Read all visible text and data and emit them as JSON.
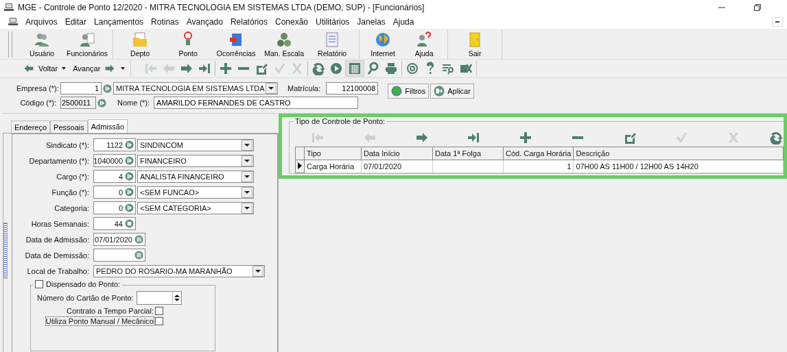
{
  "window": {
    "title": "MGE - Controle de Ponto 12/2020 - MITRA TECNOLOGIA EM SISTEMAS LTDA (DEMO, SUP) - [Funcionários]"
  },
  "menu": [
    "Arquivos",
    "Editar",
    "Lançamentos",
    "Rotinas",
    "Avançado",
    "Relatórios",
    "Conexão",
    "Utilitários",
    "Janelas",
    "Ajuda"
  ],
  "toolbar": {
    "groups": [
      [
        "Usuário",
        "Funcionários"
      ],
      [
        "Depto",
        "Ponto",
        "Ocorrências",
        "Man. Escala",
        "Relatório"
      ],
      [
        "Internet",
        "Ajuda"
      ],
      [
        "Sair"
      ]
    ]
  },
  "nav": {
    "back": "Voltar",
    "forward": "Avançar",
    "buttons": [
      {
        "disabled": true
      },
      {
        "disabled": true
      },
      {
        "disabled": false
      },
      {
        "disabled": false
      },
      {
        "disabled": false
      },
      {
        "disabled": false
      },
      {
        "disabled": false
      },
      {
        "disabled": true
      },
      {
        "disabled": true
      },
      {
        "disabled": false
      },
      {
        "disabled": false
      },
      {
        "disabled": false
      },
      {
        "disabled": false
      },
      {
        "disabled": false
      },
      {
        "disabled": false
      },
      {
        "disabled": false
      },
      {
        "disabled": false
      },
      {
        "disabled": false
      }
    ]
  },
  "header": {
    "empresa": {
      "label": "Empresa (*):",
      "code": "1",
      "name": "MITRA TECNOLOGIA EM SISTEMAS LTDA"
    },
    "matricula": {
      "label": "Matrícula:",
      "value": "12100008"
    },
    "codigo": {
      "label": "Código (*):",
      "value": "2500011"
    },
    "nome": {
      "label": "Nome (*):",
      "value": "AMARILDO FERNANDES DE CASTRO"
    },
    "buttons": [
      "Filtros",
      "Aplicar"
    ]
  },
  "tabs": [
    {
      "label": "Endereço",
      "selected": false
    },
    {
      "label": "Pessoais",
      "selected": false
    },
    {
      "label": "Admissão",
      "selected": true
    }
  ],
  "form": [
    {
      "kind": "lookup",
      "label": "Sindicato (*):",
      "code": "1122",
      "value": "SINDINCOM"
    },
    {
      "kind": "lookup",
      "label": "Departamento (*):",
      "code": "1040000",
      "value": "FINANCEIRO"
    },
    {
      "kind": "lookup",
      "label": "Cargo (*):",
      "code": "4",
      "value": "ANALISTA FINANCEIRO"
    },
    {
      "kind": "lookup",
      "label": "Função (*):",
      "code": "0",
      "value": "<SEM FUNCAO>"
    },
    {
      "kind": "lookup",
      "label": "Categoria:",
      "code": "0",
      "value": "<SEM CATEGORIA>"
    },
    {
      "kind": "number",
      "label": "Horas Semanais:",
      "value": "44"
    },
    {
      "kind": "date",
      "label": "Data de Admissão:",
      "value": "07/01/2020"
    },
    {
      "kind": "date",
      "label": "Data de Demissão:"
    },
    {
      "kind": "combo",
      "label": "Local de Trabalho:",
      "value": "PEDRO DO ROSARIO-MA MARANHÃO"
    }
  ],
  "dispensado": {
    "label": "Dispensado do Ponto:",
    "checked": false,
    "cartao": {
      "label": "Número do Cartão de Ponto:"
    },
    "options": [
      {
        "label": "Contrato a Tempo Parcial:",
        "checked": false
      },
      {
        "label": "Utiliza Ponto Manual / Mecânico",
        "checked": false
      }
    ]
  },
  "controle": {
    "title": "Tipo de Controle de Ponto:",
    "buttons": [
      {
        "disabled": true
      },
      {
        "disabled": true
      },
      {
        "disabled": false
      },
      {
        "disabled": false
      },
      {
        "disabled": false
      },
      {
        "disabled": false
      },
      {
        "disabled": false
      },
      {
        "disabled": true
      },
      {
        "disabled": true
      },
      {
        "disabled": false
      }
    ],
    "columns": [
      "Tipo",
      "Data Início",
      "Data 1ª Folga",
      "Cód. Carga Horária",
      "Descrição"
    ],
    "rows": [
      {
        "selected": true,
        "cells": [
          "Carga Horária",
          "07/01/2020",
          "",
          "1",
          "07H00 AS 11H00 / 12H00 AS 14H20"
        ]
      }
    ]
  }
}
